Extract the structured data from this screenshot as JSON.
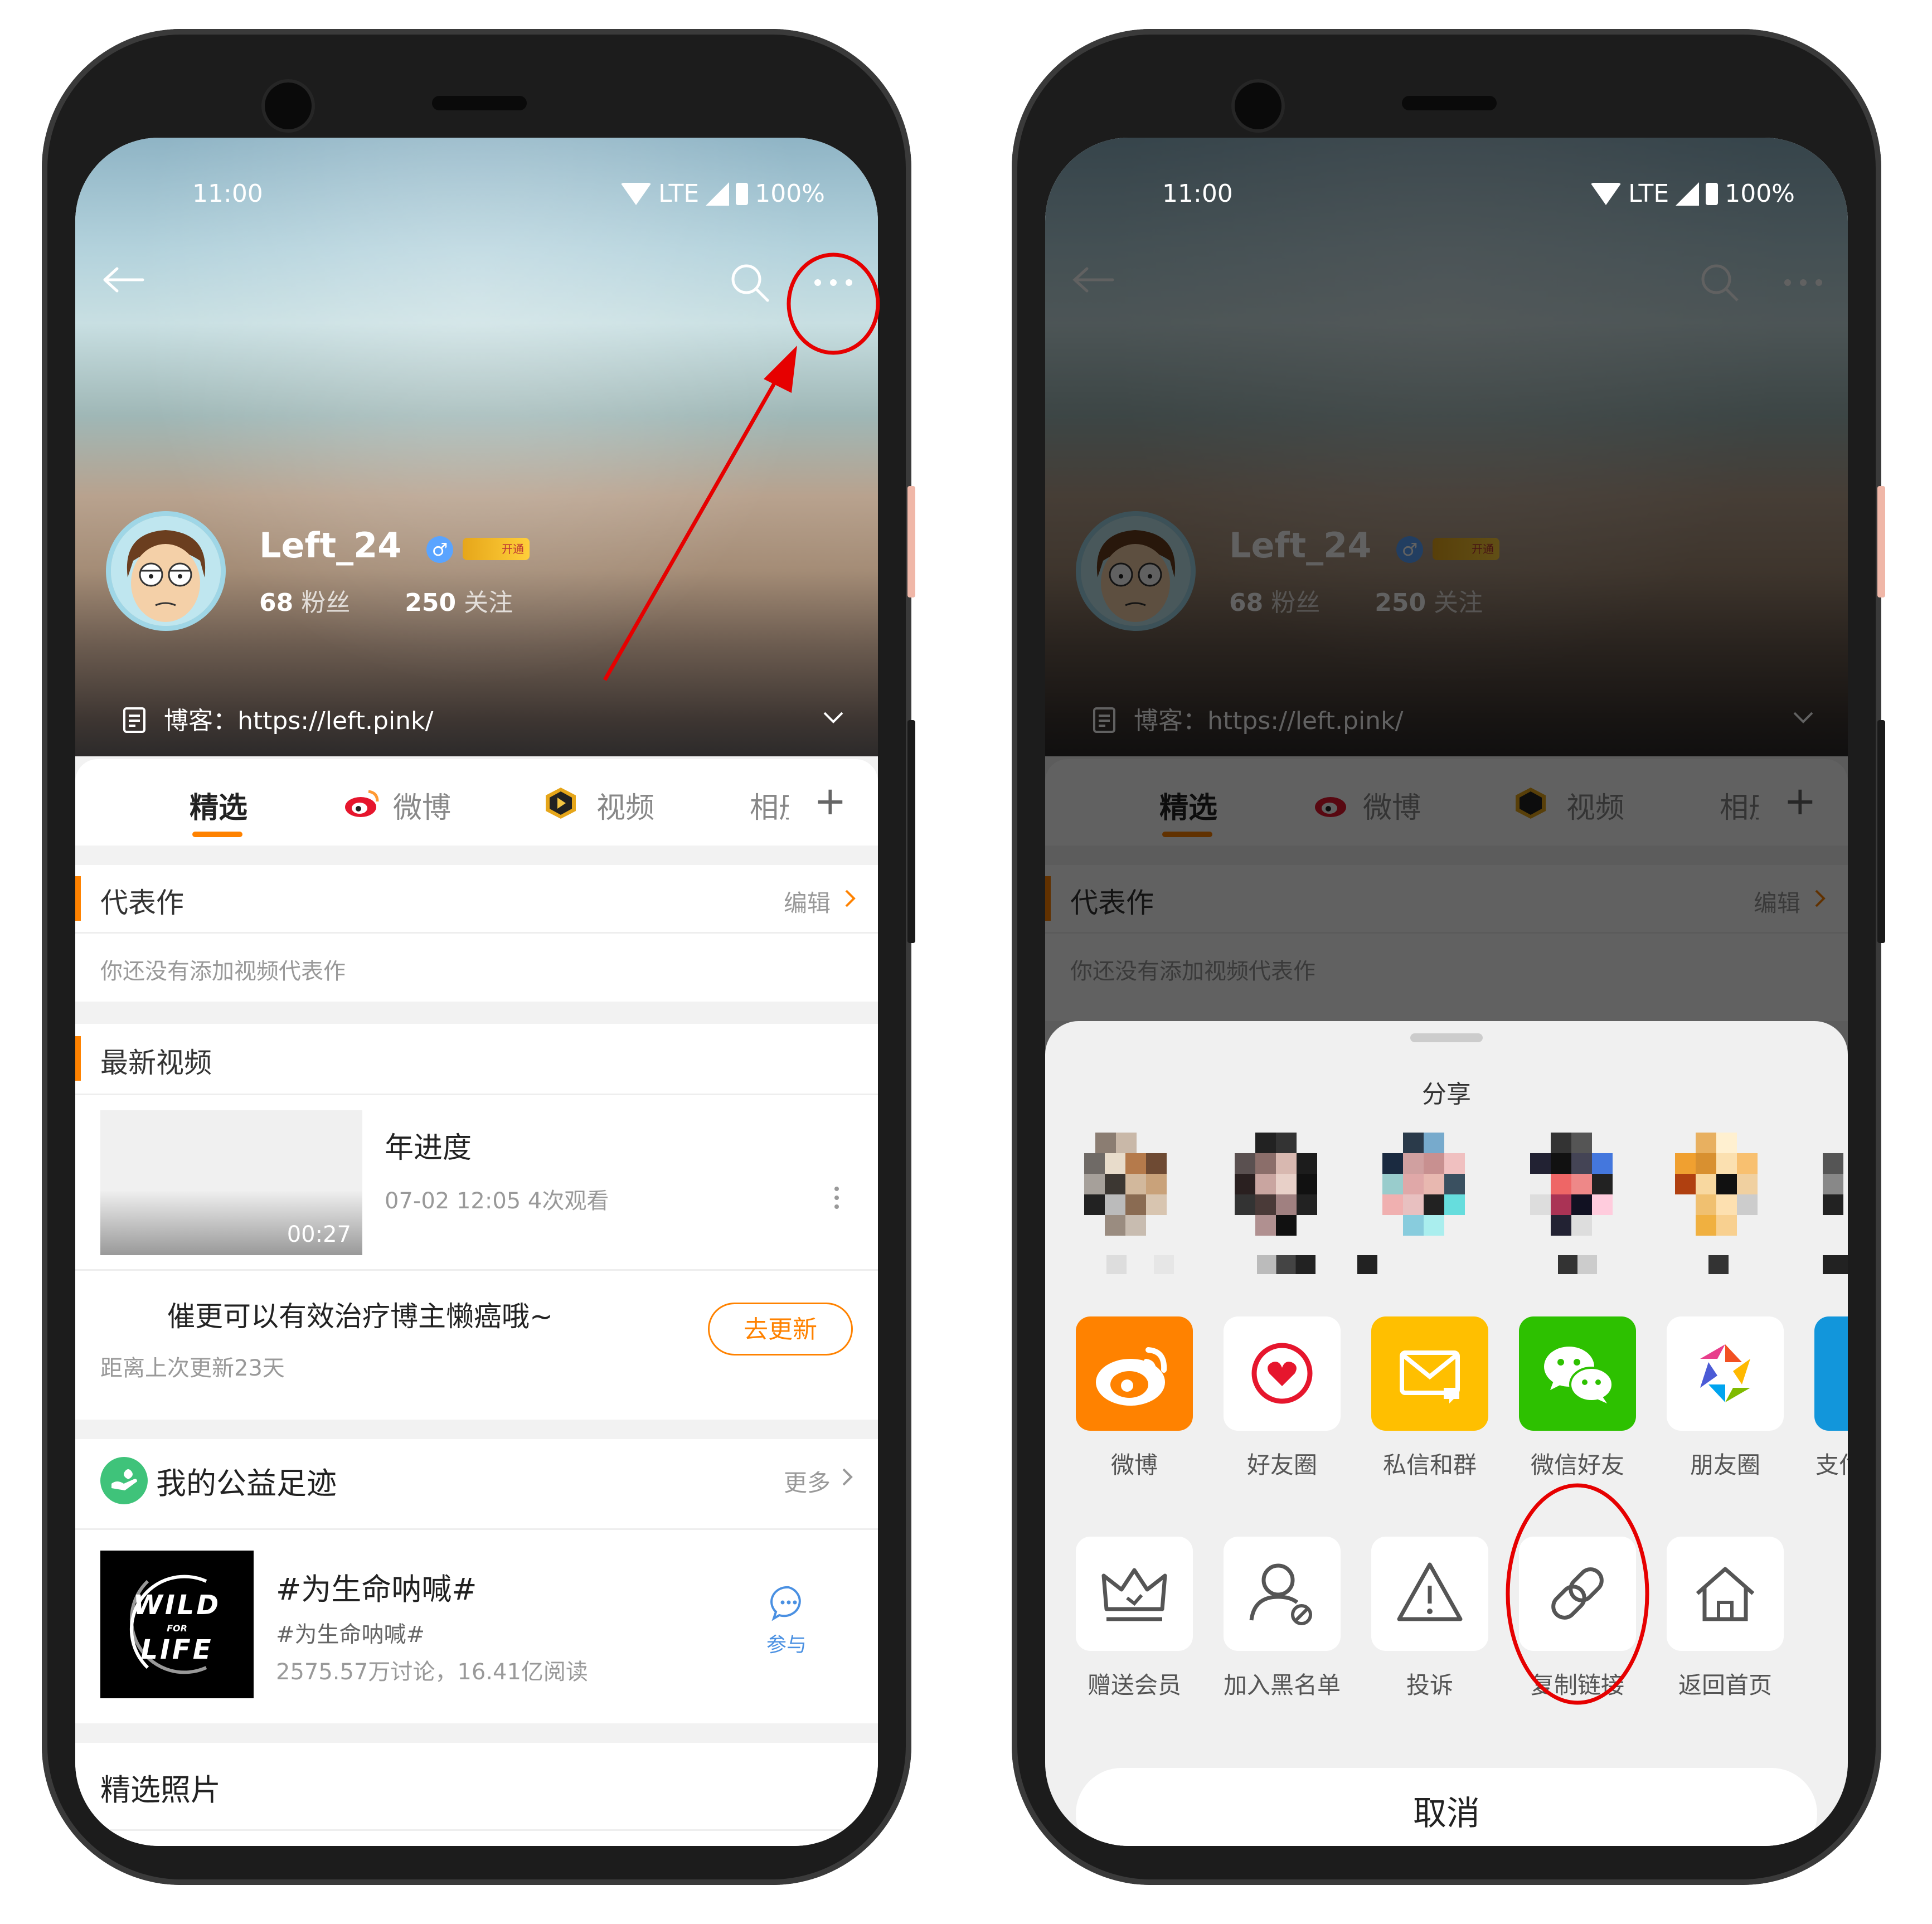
{
  "status_bar": {
    "time": "11:00",
    "network": "LTE",
    "battery": "100%"
  },
  "profile": {
    "username": "Left_24",
    "gender_badge": "♂",
    "vip_badge": "开通",
    "followers_count": "68",
    "followers_label": "粉丝",
    "following_count": "250",
    "following_label": "关注",
    "blog_label": "博客：",
    "blog_url": "https://left.pink/"
  },
  "tabs": [
    {
      "label": "精选"
    },
    {
      "label": "微博"
    },
    {
      "label": "视频"
    },
    {
      "label": "相册"
    }
  ],
  "masterpiece": {
    "title": "代表作",
    "edit": "编辑",
    "empty": "你还没有添加视频代表作"
  },
  "latest_videos": {
    "title": "最新视频",
    "video_title": "年进度",
    "duration": "00:27",
    "meta": "07-02 12:05 4次观看",
    "urge_text": "催更可以有效治疗博主懒癌哦~",
    "since_update": "距离上次更新23天",
    "update_button": "去更新"
  },
  "charity": {
    "title": "我的公益足迹",
    "more": "更多",
    "topic": "#为生命呐喊#",
    "topic_sub": "#为生命呐喊#",
    "stats": "2575.57万讨论，16.41亿阅读",
    "join": "参与",
    "image_text_1": "WILD",
    "image_text_2": "FOR",
    "image_text_3": "LIFE"
  },
  "photos": {
    "title": "精选照片"
  },
  "share_sheet": {
    "title": "分享",
    "apps": [
      {
        "label": "微博",
        "icon": "weibo-icon",
        "color": "#ff8200"
      },
      {
        "label": "好友圈",
        "icon": "friend-circle-icon",
        "color": "#ffffff"
      },
      {
        "label": "私信和群",
        "icon": "message-icon",
        "color": "#ffbf00"
      },
      {
        "label": "微信好友",
        "icon": "wechat-icon",
        "color": "#2dc100"
      },
      {
        "label": "朋友圈",
        "icon": "moments-icon",
        "color": "#ffffff"
      },
      {
        "label": "支付宝",
        "icon": "alipay-icon",
        "color": "#1296db"
      }
    ],
    "actions": [
      {
        "label": "赠送会员",
        "icon": "crown-icon"
      },
      {
        "label": "加入黑名单",
        "icon": "block-user-icon"
      },
      {
        "label": "投诉",
        "icon": "warning-icon"
      },
      {
        "label": "复制链接",
        "icon": "link-icon"
      },
      {
        "label": "返回首页",
        "icon": "home-icon"
      }
    ],
    "cancel": "取消"
  },
  "colors": {
    "accent": "#ff8200",
    "annotation": "#e60000"
  }
}
